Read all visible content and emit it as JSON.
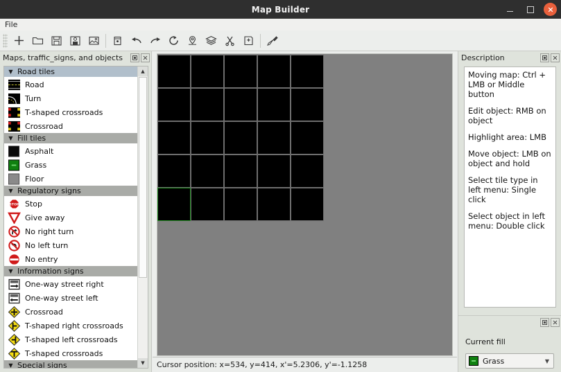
{
  "window": {
    "title": "Map Builder",
    "controls": {
      "minimize": "–",
      "maximize": "□",
      "close": "✕"
    }
  },
  "menubar": {
    "items": [
      {
        "label": "File"
      }
    ]
  },
  "toolbar": {
    "buttons": [
      {
        "name": "new-icon",
        "tip": "New"
      },
      {
        "name": "open-folder-icon",
        "tip": "Open"
      },
      {
        "name": "save-icon",
        "tip": "Save"
      },
      {
        "name": "save-as-icon",
        "tip": "Save as"
      },
      {
        "name": "export-image-icon",
        "tip": "Export image"
      },
      {
        "name": "delete-icon",
        "tip": "Delete"
      },
      {
        "name": "undo-icon",
        "tip": "Undo"
      },
      {
        "name": "redo-icon",
        "tip": "Redo"
      },
      {
        "name": "rotate-icon",
        "tip": "Rotate"
      },
      {
        "name": "map-pin-icon",
        "tip": "Place marker"
      },
      {
        "name": "layers-icon",
        "tip": "Layers"
      },
      {
        "name": "scissors-icon",
        "tip": "Cut"
      },
      {
        "name": "add-tile-icon",
        "tip": "Add tile"
      },
      {
        "name": "paint-brush-icon",
        "tip": "Fill"
      }
    ]
  },
  "left_panel": {
    "title": "Maps, traffic_signs, and objects",
    "float_button": "float",
    "close_button": "close",
    "groups": [
      {
        "label": "Road tiles",
        "selected": true,
        "items": [
          {
            "label": "Road",
            "icon": "road-tile-icon"
          },
          {
            "label": "Turn",
            "icon": "turn-tile-icon"
          },
          {
            "label": "T-shaped crossroads",
            "icon": "t-crossroads-tile-icon"
          },
          {
            "label": "Crossroad",
            "icon": "crossroad-tile-icon"
          }
        ]
      },
      {
        "label": "Fill tiles",
        "selected": false,
        "items": [
          {
            "label": "Asphalt",
            "icon": "asphalt-swatch-icon"
          },
          {
            "label": "Grass",
            "icon": "grass-swatch-icon"
          },
          {
            "label": "Floor",
            "icon": "floor-swatch-icon"
          }
        ]
      },
      {
        "label": "Regulatory signs",
        "selected": false,
        "items": [
          {
            "label": "Stop",
            "icon": "stop-sign-icon"
          },
          {
            "label": "Give away",
            "icon": "give-way-sign-icon"
          },
          {
            "label": "No right turn",
            "icon": "no-right-turn-sign-icon"
          },
          {
            "label": "No left turn",
            "icon": "no-left-turn-sign-icon"
          },
          {
            "label": "No entry",
            "icon": "no-entry-sign-icon"
          }
        ]
      },
      {
        "label": "Information signs",
        "selected": false,
        "items": [
          {
            "label": "One-way street right",
            "icon": "one-way-right-sign-icon"
          },
          {
            "label": "One-way street left",
            "icon": "one-way-left-sign-icon"
          },
          {
            "label": "Crossroad",
            "icon": "crossroad-sign-icon"
          },
          {
            "label": "T-shaped right crossroads",
            "icon": "t-right-crossroads-sign-icon"
          },
          {
            "label": "T-shaped left crossroads",
            "icon": "t-left-crossroads-sign-icon"
          },
          {
            "label": "T-shaped crossroads",
            "icon": "t-crossroads-sign-icon"
          }
        ]
      },
      {
        "label": "Special signs",
        "selected": false,
        "items": []
      }
    ]
  },
  "canvas": {
    "background_color": "#808080",
    "tile_color": "#000000",
    "grid_line_color": "#6e6e6e",
    "highlight_color": "#1f8a1f",
    "columns": 5,
    "rows": 5,
    "tile_size": 48,
    "highlighted_cell": {
      "col": 0,
      "row": 4
    }
  },
  "statusbar": {
    "text": "Cursor position: x=534, y=414, x'=5.2306, y'=-1.1258"
  },
  "description_panel": {
    "title": "Description",
    "float_button": "float",
    "close_button": "close",
    "lines": [
      "Moving map: Ctrl + LMB or Middle button",
      "Edit object: RMB on object",
      "Highlight area: LMB",
      "Move object: LMB on object and hold",
      "Select tile type in left menu: Single click",
      "Select object in left menu: Double click"
    ]
  },
  "current_fill_panel": {
    "float_button": "float",
    "close_button": "close",
    "label": "Current fill",
    "selected": "Grass",
    "selected_color": "#108010",
    "dropdown_arrow": "▼"
  }
}
